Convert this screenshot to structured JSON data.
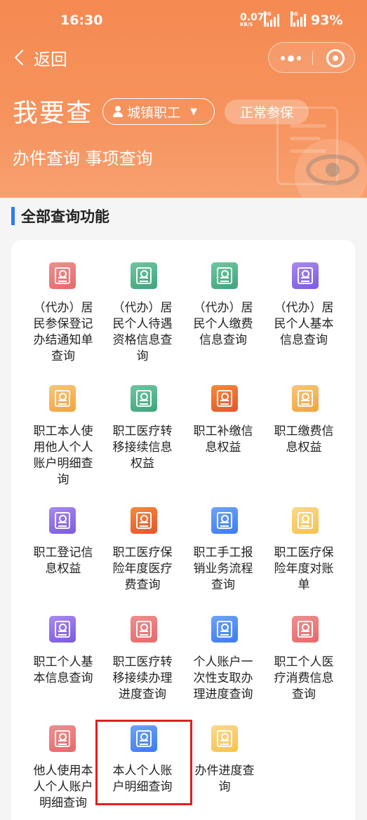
{
  "status_bar": {
    "time": "16:30",
    "net_speed": "0.07",
    "net_unit": "KB/S",
    "signal_a": "5G",
    "signal_b": "5G",
    "battery": "93%"
  },
  "nav": {
    "back_label": "返回"
  },
  "header": {
    "title": "我要查",
    "insurance_type": "城镇职工",
    "insurance_status": "正常参保",
    "subtitle": "办件查询 事项查询"
  },
  "section": {
    "title": "全部查询功能"
  },
  "colors": {
    "header_orange": "#f58a52",
    "accent_blue": "#2f7bf5",
    "highlight_red": "#e0201f"
  },
  "items": [
    {
      "label": "（代办）居民参保登记办结通知单查询",
      "icon": "voice-notice-icon",
      "color": "red"
    },
    {
      "label": "（代办）居民个人待遇资格信息查询",
      "icon": "search-certificate-icon",
      "color": "green"
    },
    {
      "label": "（代办）居民个人缴费信息查询",
      "icon": "search-payment-icon",
      "color": "green"
    },
    {
      "label": "（代办）居民个人基本信息查询",
      "icon": "search-profile-icon",
      "color": "purple"
    },
    {
      "label": "职工本人使用他人个人账户明细查询",
      "icon": "search-ledger-icon",
      "color": "orange"
    },
    {
      "label": "职工医疗转移接续信息权益",
      "icon": "transfer-badge-icon",
      "color": "green"
    },
    {
      "label": "职工补缴信息权益",
      "icon": "supplement-payment-icon",
      "color": "deep"
    },
    {
      "label": "职工缴费信息权益",
      "icon": "payment-badge-icon",
      "color": "orange"
    },
    {
      "label": "职工登记信息权益",
      "icon": "star-registration-icon",
      "color": "purple"
    },
    {
      "label": "职工医疗保险年度医疗费查询",
      "icon": "medical-shield-icon",
      "color": "deep"
    },
    {
      "label": "职工手工报销业务流程查询",
      "icon": "search-workflow-icon",
      "color": "blue"
    },
    {
      "label": "职工医疗保险年度对账单",
      "icon": "annual-statement-icon",
      "color": "yellow"
    },
    {
      "label": "职工个人基本信息查询",
      "icon": "search-profile-icon",
      "color": "purple"
    },
    {
      "label": "职工医疗转移接续办理进度查询",
      "icon": "search-transfer-icon",
      "color": "red"
    },
    {
      "label": "个人账户一次性支取办理进度查询",
      "icon": "search-withdraw-icon",
      "color": "blue"
    },
    {
      "label": "职工个人医疗消费信息查询",
      "icon": "search-consumption-icon",
      "color": "red"
    },
    {
      "label": "他人使用本人个人账户明细查询",
      "icon": "search-ledger-icon",
      "color": "red"
    },
    {
      "label": "本人个人账户明细查询",
      "icon": "account-detail-icon",
      "color": "blue"
    },
    {
      "label": "办件进度查询",
      "icon": "progress-clipboard-icon",
      "color": "yellow"
    }
  ]
}
